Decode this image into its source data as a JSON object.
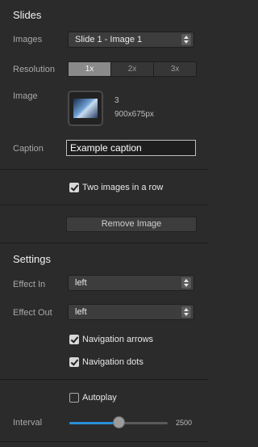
{
  "slides": {
    "title": "Slides",
    "images_label": "Images",
    "images_value": "Slide 1 - Image 1",
    "resolution_label": "Resolution",
    "resolution_options": [
      "1x",
      "2x",
      "3x"
    ],
    "resolution_selected": "1x",
    "image_label": "Image",
    "image_count": "3",
    "image_size": "900x675px",
    "caption_label": "Caption",
    "caption_value": "Example caption",
    "two_images_label": "Two images in a row",
    "two_images_checked": true,
    "remove_button": "Remove Image"
  },
  "settings": {
    "title": "Settings",
    "effect_in_label": "Effect In",
    "effect_in_value": "left",
    "effect_out_label": "Effect Out",
    "effect_out_value": "left",
    "nav_arrows_label": "Navigation arrows",
    "nav_arrows_checked": true,
    "nav_dots_label": "Navigation dots",
    "nav_dots_checked": true,
    "autoplay_label": "Autoplay",
    "autoplay_checked": false,
    "interval_label": "Interval",
    "interval_value": "2500",
    "interval_fill_fraction": 0.5
  },
  "colors": {
    "background": "#2b2b2b",
    "accent": "#2a8fd6"
  }
}
